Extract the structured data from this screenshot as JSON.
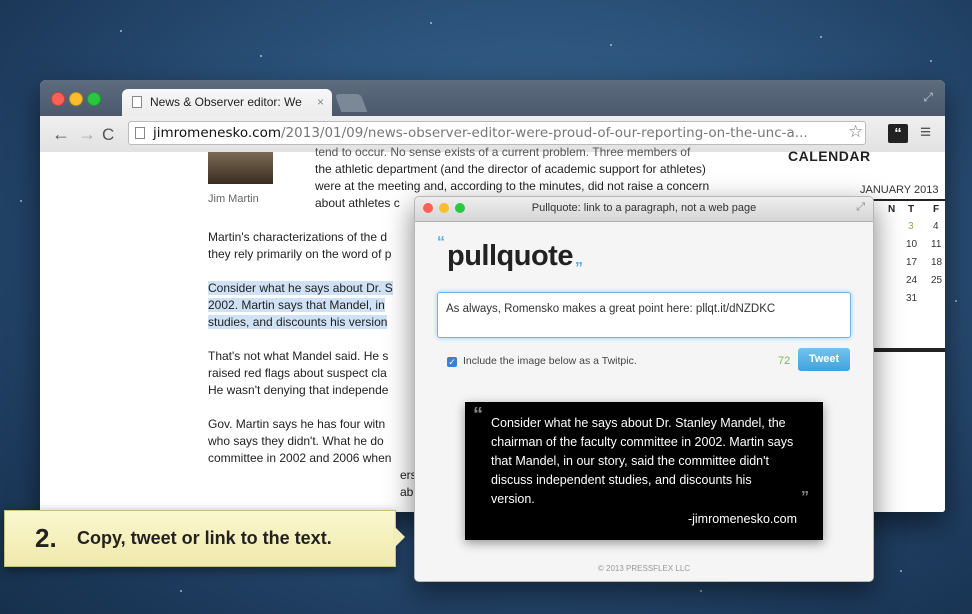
{
  "browser": {
    "tab_title": "News & Observer editor: We",
    "tab_close": "×",
    "url_domain": "jimromenesko.com",
    "url_path": "/2013/01/09/news-observer-editor-were-proud-of-our-reporting-on-the-unc-a..."
  },
  "article": {
    "top_lines": [
      "tend to occur. No sense exists of a current problem. Three members of",
      "the athletic department (and the director of academic support for athletes)",
      "were at the meeting and, according to the minutes, did not raise a concern",
      "about athletes c"
    ],
    "photo_caption": "Jim Martin",
    "para1": [
      "Martin's characterizations of the d",
      "they rely primarily on the word of p"
    ],
    "para2": [
      "Consider what he says about Dr. S",
      "2002. Martin says that Mandel, in",
      "studies, and discounts his version"
    ],
    "para3": [
      "That's not what Mandel said. He s",
      "raised red flags about suspect cla",
      "He wasn't denying that independe"
    ],
    "para4": [
      "Gov. Martin says he has four witn",
      "who says they didn't. What he do",
      "committee in 2002 and 2006 when",
      "ers",
      "abu"
    ]
  },
  "calendar": {
    "title": "CALENDAR",
    "month": "JANUARY 2013",
    "headers": [
      "N",
      "T",
      "F"
    ],
    "rows": [
      [
        "",
        "3",
        "4"
      ],
      [
        "",
        "10",
        "11"
      ],
      [
        "",
        "17",
        "18"
      ],
      [
        "",
        "24",
        "25"
      ],
      [
        "",
        "31",
        ""
      ]
    ]
  },
  "popup": {
    "window_title": "Pullquote: link to a paragraph, not a web page",
    "logo_open": "“",
    "logo": "pullquote",
    "logo_close": "”",
    "tweet_text": "As always, Romensko makes a great point here: pllqt.it/dNZDKC",
    "include_label": "Include the image below as a Twitpic.",
    "char_count": "72",
    "tweet_button": "Tweet",
    "quote_lines": [
      "Consider what he says about Dr. Stanley Mandel, the",
      "chairman of the faculty committee in 2002. Martin says",
      "that Mandel, in our story, said the committee didn't",
      "discuss independent studies, and discounts his",
      "version."
    ],
    "quote_attribution": "-jimromenesko.com",
    "footer": "© 2013 PRESSFLEX LLC"
  },
  "callout": {
    "number": "2.",
    "text": "Copy, tweet or link to the text."
  }
}
